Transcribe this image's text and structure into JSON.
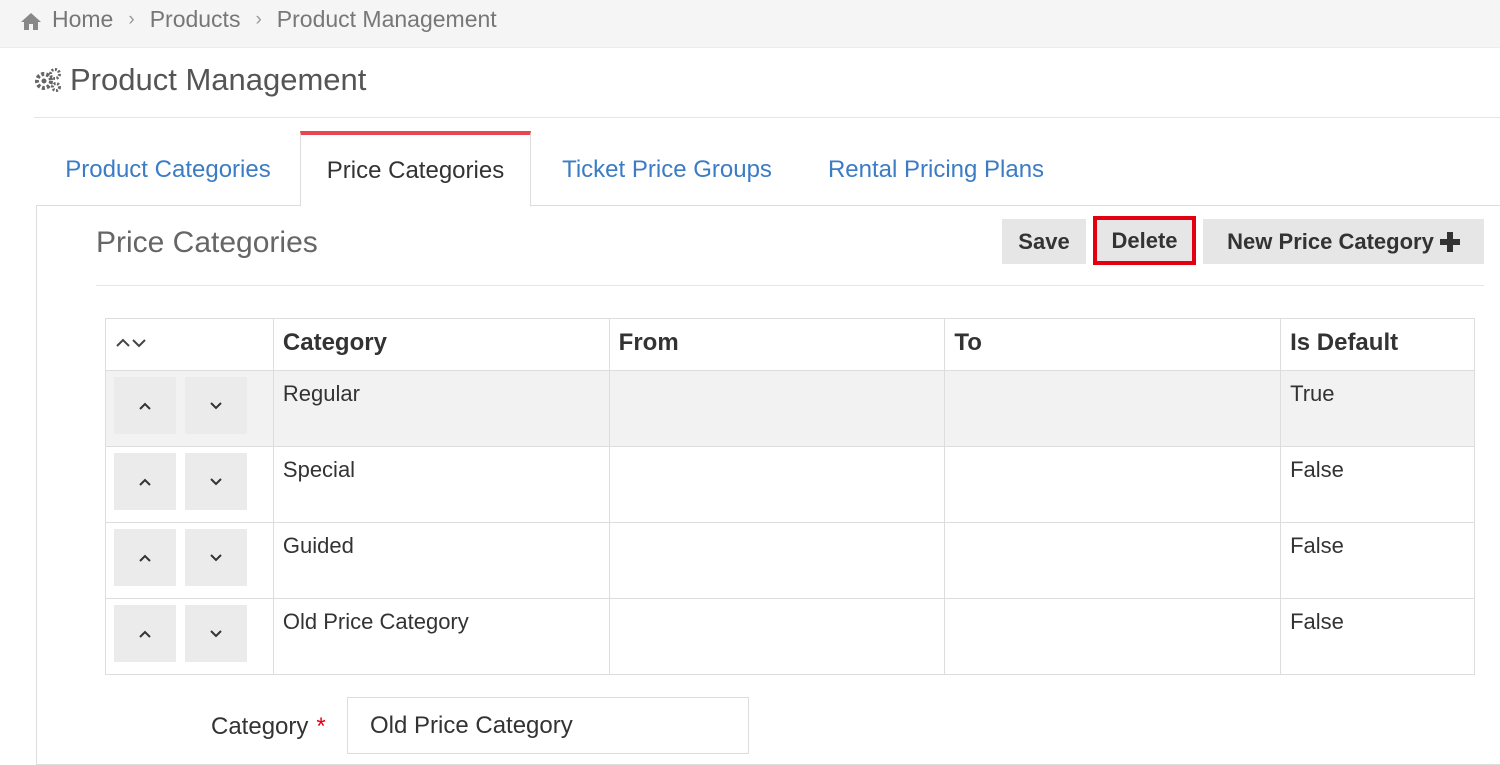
{
  "breadcrumb": {
    "items": [
      "Home",
      "Products",
      "Product Management"
    ]
  },
  "page": {
    "title": "Product Management"
  },
  "tabs": [
    {
      "label": "Product Categories",
      "active": false
    },
    {
      "label": "Price Categories",
      "active": true
    },
    {
      "label": "Ticket Price Groups",
      "active": false
    },
    {
      "label": "Rental Pricing Plans",
      "active": false
    }
  ],
  "section": {
    "title": "Price Categories"
  },
  "toolbar": {
    "save_label": "Save",
    "delete_label": "Delete",
    "new_label": "New Price Category"
  },
  "table": {
    "sort_header": "^v",
    "columns": [
      "Category",
      "From",
      "To",
      "Is Default"
    ],
    "rows": [
      {
        "category": "Regular",
        "from": "",
        "to": "",
        "is_default": "True"
      },
      {
        "category": "Special",
        "from": "",
        "to": "",
        "is_default": "False"
      },
      {
        "category": "Guided",
        "from": "",
        "to": "",
        "is_default": "False"
      },
      {
        "category": "Old Price Category",
        "from": "",
        "to": "",
        "is_default": "False"
      }
    ]
  },
  "form": {
    "category_label": "Category",
    "required_mark": "*",
    "category_value": "Old Price Category"
  },
  "colors": {
    "link": "#3b7cc4",
    "active_tab_accent": "#e8474f",
    "highlight": "#e3000f",
    "button_bg": "#e6e6e6"
  },
  "icons": {
    "breadcrumb_home": "home-icon",
    "breadcrumb_separator": "chevron-right-icon",
    "page_title": "gears-icon",
    "new_button": "plus-icon",
    "move_up": "chevron-up-icon",
    "move_down": "chevron-down-icon"
  }
}
